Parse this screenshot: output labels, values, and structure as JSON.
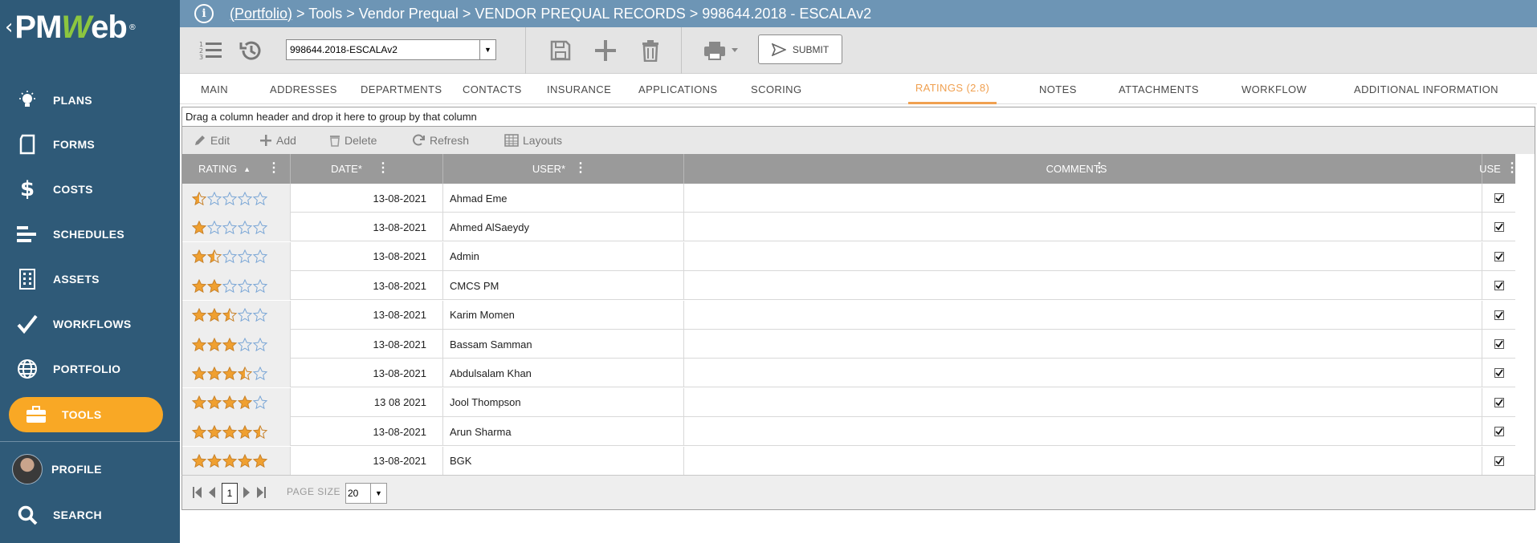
{
  "sidebar": {
    "logo": "PMWeb",
    "items": [
      {
        "label": "PLANS",
        "icon": "lightbulb-icon"
      },
      {
        "label": "FORMS",
        "icon": "document-icon"
      },
      {
        "label": "COSTS",
        "icon": "dollar-icon"
      },
      {
        "label": "SCHEDULES",
        "icon": "gantt-bars-icon"
      },
      {
        "label": "ASSETS",
        "icon": "building-icon"
      },
      {
        "label": "WORKFLOWS",
        "icon": "checkmark-icon"
      },
      {
        "label": "PORTFOLIO",
        "icon": "globe-icon"
      },
      {
        "label": "TOOLS",
        "icon": "briefcase-icon",
        "active": true
      },
      {
        "label": "PROFILE",
        "icon": "avatar"
      },
      {
        "label": "SEARCH",
        "icon": "search-icon"
      }
    ],
    "active_color": "#f9a825",
    "background": "#2f5a78"
  },
  "breadcrumb": {
    "link": "(Portfolio)",
    "rest": " > Tools > Vendor Prequal > VENDOR PREQUAL RECORDS > 998644.2018 - ESCALAv2"
  },
  "toolbar": {
    "record_value": "998644.2018-ESCALAv2",
    "submit_label": "SUBMIT"
  },
  "tabs": [
    {
      "label": "MAIN"
    },
    {
      "label": "ADDRESSES"
    },
    {
      "label": "DEPARTMENTS"
    },
    {
      "label": "CONTACTS"
    },
    {
      "label": "INSURANCE"
    },
    {
      "label": "APPLICATIONS"
    },
    {
      "label": "SCORING"
    },
    {
      "label": "RATINGS (2.8)",
      "active": true
    },
    {
      "label": "NOTES"
    },
    {
      "label": "ATTACHMENTS"
    },
    {
      "label": "WORKFLOW"
    },
    {
      "label": "ADDITIONAL INFORMATION"
    }
  ],
  "grid": {
    "group_hint": "Drag a column header and drop it here to group by that column",
    "actions": {
      "edit": "Edit",
      "add": "Add",
      "delete": "Delete",
      "refresh": "Refresh",
      "layouts": "Layouts"
    },
    "columns": {
      "rating": "RATING",
      "date": "DATE*",
      "user": "USER*",
      "comments": "COMMENTS",
      "use": "USE"
    },
    "rows": [
      {
        "rating": 0.5,
        "date": "13-08-2021",
        "user": "Ahmad Eme",
        "comments": "",
        "use": true
      },
      {
        "rating": 1,
        "date": "13-08-2021",
        "user": "Ahmed AlSaeydy",
        "comments": "",
        "use": true
      },
      {
        "rating": 1.5,
        "date": "13-08-2021",
        "user": "Admin",
        "comments": "",
        "use": true
      },
      {
        "rating": 2,
        "date": "13-08-2021",
        "user": "CMCS PM",
        "comments": "",
        "use": true
      },
      {
        "rating": 2.5,
        "date": "13-08-2021",
        "user": "Karim Momen",
        "comments": "",
        "use": true
      },
      {
        "rating": 3,
        "date": "13-08-2021",
        "user": "Bassam Samman",
        "comments": "",
        "use": true
      },
      {
        "rating": 3.5,
        "date": "13-08-2021",
        "user": "Abdulsalam Khan",
        "comments": "",
        "use": true
      },
      {
        "rating": 4,
        "date": "13 08 2021",
        "user": "Jool Thompson",
        "comments": "",
        "use": true
      },
      {
        "rating": 4.5,
        "date": "13-08-2021",
        "user": "Arun Sharma",
        "comments": "",
        "use": true
      },
      {
        "rating": 5,
        "date": "13-08-2021",
        "user": "BGK",
        "comments": "",
        "use": true
      }
    ],
    "star_color": "#f0a030",
    "star_empty_color": "#7aa6d6"
  },
  "pager": {
    "page": "1",
    "page_size_label": "PAGE SIZE",
    "page_size": "20"
  }
}
